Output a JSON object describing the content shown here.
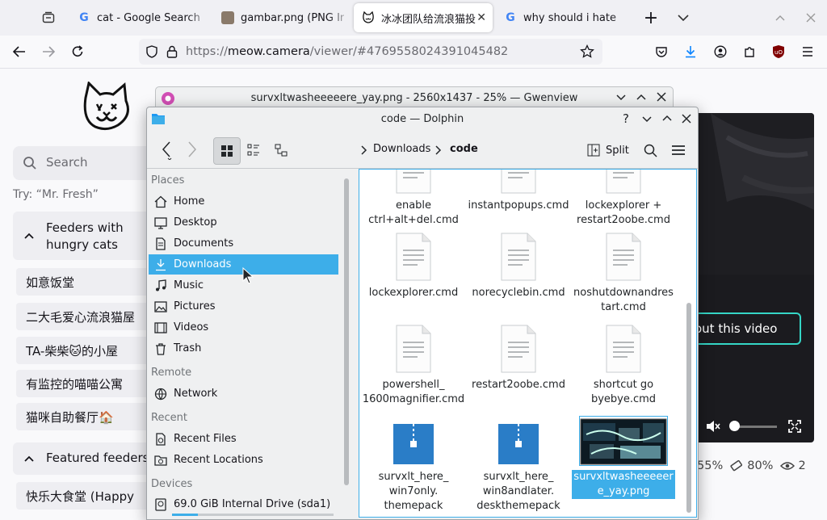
{
  "browser": {
    "tabs": [
      {
        "title": "cat - Google Search",
        "active": false
      },
      {
        "title": "gambar.png (PNG Image",
        "active": false
      },
      {
        "title": "冰冰团队给流浪猫投喂",
        "active": true
      },
      {
        "title": "why should i hate",
        "active": false
      }
    ],
    "new_tab_label": "+",
    "url_scheme": "https://",
    "url_host": "meow.camera",
    "url_path": "/viewer/#4769558024391045482"
  },
  "webpage": {
    "search_placeholder": "Search",
    "try_hint": "Try: “Mr. Fresh”",
    "sections": [
      {
        "title": "Feeders with hungry cats"
      },
      {
        "title": "Featured feeders"
      }
    ],
    "feeders": [
      "如意饭堂",
      "二大毛爱心流浪猫屋",
      "TA-柴柴🐱的小屋",
      "有监控的喵喵公寓",
      "猫咪自助餐厅🏠"
    ],
    "featured": [
      "快乐大食堂 (Happy"
    ],
    "video_button": "out this video",
    "stats": {
      "food": "55%",
      "battery": "80%",
      "viewers": "2"
    }
  },
  "gwenview": {
    "title": "survxltwasheeeeere_yay.png - 2560x1437 - 25% — Gwenview"
  },
  "dolphin": {
    "title": "code — Dolphin",
    "breadcrumb": [
      "Downloads",
      "code"
    ],
    "split_label": "Split",
    "places": {
      "places_header": "Places",
      "places": [
        "Home",
        "Desktop",
        "Documents",
        "Downloads",
        "Music",
        "Pictures",
        "Videos",
        "Trash"
      ],
      "remote_header": "Remote",
      "remote": [
        "Network"
      ],
      "recent_header": "Recent",
      "recent": [
        "Recent Files",
        "Recent Locations"
      ],
      "devices_header": "Devices",
      "devices": [
        "69.0 GiB Internal Drive (sda1)"
      ],
      "selected": "Downloads",
      "drive_usage": 0.16
    },
    "files": [
      {
        "name": "enable ctrl+alt+del.cmd",
        "type": "text"
      },
      {
        "name": "instantpopups.cmd",
        "type": "text"
      },
      {
        "name": "lockexplorer + restart2oobe.cmd",
        "type": "text"
      },
      {
        "name": "lockexplorer.cmd",
        "type": "text"
      },
      {
        "name": "norecyclebin.cmd",
        "type": "text"
      },
      {
        "name": "noshutdownandrestart.cmd",
        "type": "text"
      },
      {
        "name": "powershell_ 1600magnifier.cmd",
        "type": "text"
      },
      {
        "name": "restart2oobe.cmd",
        "type": "text"
      },
      {
        "name": "shortcut go byebye.cmd",
        "type": "text"
      },
      {
        "name": "survxlt_here_ win7only. themepack",
        "type": "archive"
      },
      {
        "name": "survxlt_here_ win8andlater. deskthemepack",
        "type": "archive"
      },
      {
        "name": "survxltwasheeeeere_yay.png",
        "type": "image",
        "selected": true
      }
    ]
  }
}
